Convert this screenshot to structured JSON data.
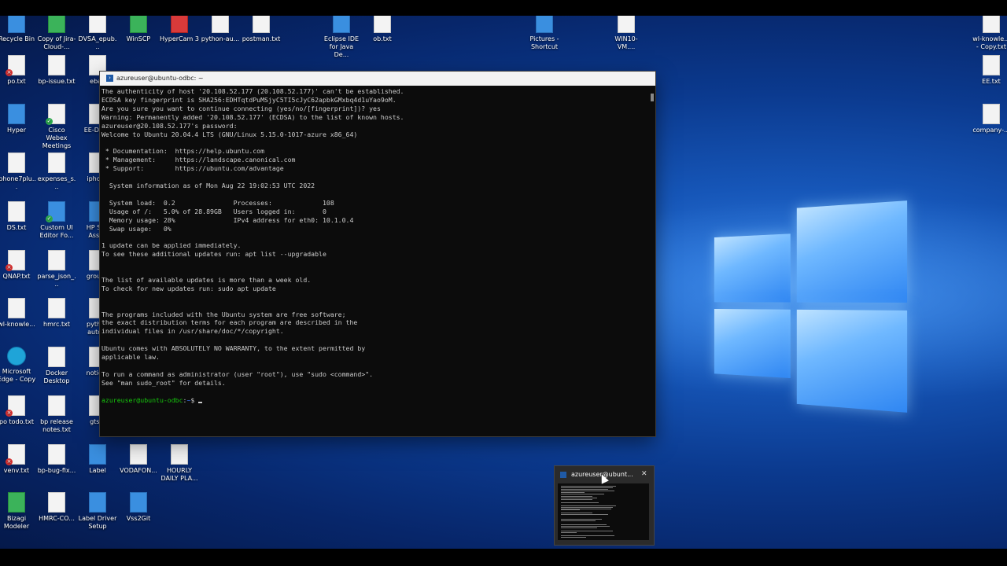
{
  "desktop": {
    "icons": [
      {
        "name": "recycle-bin",
        "label": "Recycle Bin",
        "type": "blue"
      },
      {
        "name": "copy-of-jira",
        "label": "Copy of Jira-Cloud-...",
        "type": "green"
      },
      {
        "name": "dvsa-epub",
        "label": "DVSA_epub...",
        "type": "doc"
      },
      {
        "name": "winscp",
        "label": "WinSCP",
        "type": "green"
      },
      {
        "name": "hypercam",
        "label": "HyperCam 3",
        "type": "red"
      },
      {
        "name": "python-au",
        "label": "python-au...",
        "type": "doc"
      },
      {
        "name": "postman",
        "label": "postman.txt",
        "type": "doc"
      },
      {
        "name": "eclipse",
        "label": "Eclipse IDE for Java De...",
        "type": "blue"
      },
      {
        "name": "ob-txt",
        "label": "ob.txt",
        "type": "doc"
      },
      {
        "name": "pictures-shortcut",
        "label": "Pictures - Shortcut",
        "type": "blue"
      },
      {
        "name": "win10-vm",
        "label": "WIN10-VM....",
        "type": "doc"
      },
      {
        "name": "wl-knowle-copy",
        "label": "wl-knowle... - Copy.txt",
        "type": "doc"
      },
      {
        "name": "po-txt",
        "label": "po.txt",
        "type": "doc",
        "badge": "x"
      },
      {
        "name": "bp-issue",
        "label": "bp-issue.txt",
        "type": "doc"
      },
      {
        "name": "ebay",
        "label": "ebay",
        "type": "doc"
      },
      {
        "name": "ee-txt",
        "label": "EE.txt",
        "type": "doc"
      },
      {
        "name": "hyper",
        "label": "Hyper",
        "type": "blue"
      },
      {
        "name": "cisco-webex",
        "label": "Cisco Webex Meetings",
        "type": "doc",
        "badge": "ok"
      },
      {
        "name": "ee-desk",
        "label": "EE-DESK",
        "type": "doc"
      },
      {
        "name": "company",
        "label": "company-...",
        "type": "doc"
      },
      {
        "name": "iphone7plu",
        "label": "iphone7plu...",
        "type": "doc"
      },
      {
        "name": "expenses",
        "label": "expenses_s...",
        "type": "doc"
      },
      {
        "name": "iphone",
        "label": "iphone",
        "type": "doc"
      },
      {
        "name": "ds-txt",
        "label": "DS.txt",
        "type": "doc"
      },
      {
        "name": "custom-ui-editor",
        "label": "Custom UI Editor Fo...",
        "type": "blue",
        "badge": "ok"
      },
      {
        "name": "hp-support",
        "label": "HP Sup Assist",
        "type": "blue"
      },
      {
        "name": "qnap",
        "label": "QNAP.txt",
        "type": "doc",
        "badge": "x"
      },
      {
        "name": "parse-json",
        "label": "parse_json_...",
        "type": "doc"
      },
      {
        "name": "groupo",
        "label": "groupo",
        "type": "doc"
      },
      {
        "name": "wl-knowle",
        "label": "wl-knowle...",
        "type": "doc"
      },
      {
        "name": "hmrc-txt",
        "label": "hmrc.txt",
        "type": "doc"
      },
      {
        "name": "python-autom",
        "label": "python autom",
        "type": "doc"
      },
      {
        "name": "edge-copy",
        "label": "Microsoft Edge - Copy",
        "type": "edge"
      },
      {
        "name": "docker-desktop",
        "label": "Docker Desktop",
        "type": "doc"
      },
      {
        "name": "notice",
        "label": "notice_",
        "type": "doc"
      },
      {
        "name": "po-todo",
        "label": "po todo.txt",
        "type": "doc",
        "badge": "x"
      },
      {
        "name": "bp-release-notes",
        "label": "bp release notes.txt",
        "type": "doc"
      },
      {
        "name": "gtsa",
        "label": "gtsa.",
        "type": "doc"
      },
      {
        "name": "venv",
        "label": "venv.txt",
        "type": "doc",
        "badge": "x"
      },
      {
        "name": "bp-bug-fix",
        "label": "bp-bug-fix...",
        "type": "doc"
      },
      {
        "name": "label",
        "label": "Label",
        "type": "blue"
      },
      {
        "name": "vodafone",
        "label": "VODAFON...",
        "type": "doc"
      },
      {
        "name": "hourly-daily",
        "label": "HOURLY DAILY PLA...",
        "type": "doc"
      },
      {
        "name": "bizagi",
        "label": "Bizagi Modeler",
        "type": "green"
      },
      {
        "name": "hmrc-co",
        "label": "HMRC-CO...",
        "type": "doc"
      },
      {
        "name": "label-driver",
        "label": "Label Driver Setup",
        "type": "blue"
      },
      {
        "name": "vss2git",
        "label": "Vss2Git",
        "type": "blue"
      }
    ]
  },
  "terminal": {
    "title": "azureuser@ubuntu-odbc: ~",
    "lines": [
      "The authenticity of host '20.108.52.177 (20.108.52.177)' can't be established.",
      "ECDSA key fingerprint is SHA256:EDHTqtdPuMSjyC5TI5cJyC62apbkGMxbq4d1uYao9oM.",
      "Are you sure you want to continue connecting (yes/no/[fingerprint])? yes",
      "Warning: Permanently added '20.108.52.177' (ECDSA) to the list of known hosts.",
      "azureuser@20.108.52.177's password:",
      "Welcome to Ubuntu 20.04.4 LTS (GNU/Linux 5.15.0-1017-azure x86_64)",
      "",
      " * Documentation:  https://help.ubuntu.com",
      " * Management:     https://landscape.canonical.com",
      " * Support:        https://ubuntu.com/advantage",
      "",
      "  System information as of Mon Aug 22 19:02:53 UTC 2022",
      "",
      "  System load:  0.2               Processes:             108",
      "  Usage of /:   5.0% of 28.89GB   Users logged in:       0",
      "  Memory usage: 28%               IPv4 address for eth0: 10.1.0.4",
      "  Swap usage:   0%",
      "",
      "1 update can be applied immediately.",
      "To see these additional updates run: apt list --upgradable",
      "",
      "",
      "The list of available updates is more than a week old.",
      "To check for new updates run: sudo apt update",
      "",
      "",
      "The programs included with the Ubuntu system are free software;",
      "the exact distribution terms for each program are described in the",
      "individual files in /usr/share/doc/*/copyright.",
      "",
      "Ubuntu comes with ABSOLUTELY NO WARRANTY, to the extent permitted by",
      "applicable law.",
      "",
      "To run a command as administrator (user \"root\"), use \"sudo <command>\".",
      "See \"man sudo_root\" for details.",
      ""
    ],
    "prompt_user": "azureuser@ubuntu-odbc",
    "prompt_sep": ":",
    "prompt_path": "~",
    "prompt_symbol": "$ "
  },
  "preview": {
    "title": "azureuser@ubunt...",
    "close": "✕"
  }
}
